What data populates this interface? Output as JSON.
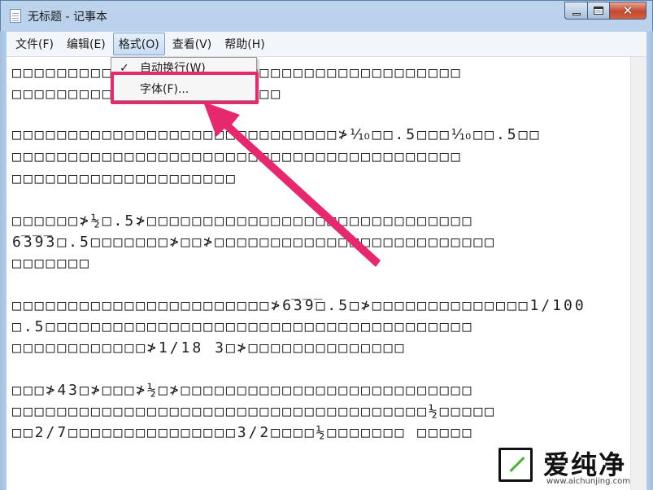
{
  "window": {
    "title": "无标题 - 记事本",
    "icon": "notepad-icon",
    "buttons": {
      "minimize": "minimize-icon",
      "maximize": "maximize-icon",
      "close": "✕"
    }
  },
  "menubar": {
    "items": [
      {
        "label": "文件(F)"
      },
      {
        "label": "编辑(E)"
      },
      {
        "label": "格式(O)",
        "active": true
      },
      {
        "label": "查看(V)"
      },
      {
        "label": "帮助(H)"
      }
    ]
  },
  "format_menu": {
    "items": [
      {
        "label": "自动换行(W)",
        "checked": true,
        "check_glyph": "✓"
      },
      {
        "label": "字体(F)..."
      }
    ]
  },
  "editor": {
    "lines": [
      "□□□□□□□□□□□□□□□□□□□□□□□□□□□□□□□□□□□□□□□□",
      "□□□□□□□□□□□□□□□□□□□□□□□□",
      "□□□□□□□□□□□□□□□□□□□□□□□□□□□□□≯⅒□□.5□□□⅒□□.5□□",
      "□□□□□□□□□□□□□□□□□□□□□□□□□□□□□□□□□□□□□□□□",
      "□□□□□□□□□□□□□□□□□□□□",
      "□□□□□□≯½□.5≯□□□□□□□□□□□□□□□□□□□□□□□□□□□□□",
      "6̅3̅9̅3□.5□□□□□□□≯□□≯□□□□□□□□□□□□□□□□□□□□□□□□□",
      "□□□□□□□",
      "□□□□□□□□□□□□□□□□□□□□□□□≯6̅3̅9̅□.5□≯□□□□□□□□□□□□□□1/100",
      "□.5□□□□□□□□□□□□□□□□□□□□□□□□□□□□□□□□□□□□□□",
      "□□□□□□□□□□□□≯1/18 3□≯□□□□□□□□□□□□□□",
      "□□□≯43□≯□□□≯½□≯□□□□□□□□□□□□□□□□□□□□□□□□□□",
      "□□□□□□□□□□□□□□□□□□□□□□□□□□□□□□□□□□□□□½□□□□□",
      "□□2/7□□□□□□□□□□□□□□□3/2□□□□½□□□□□□□ □□□□□"
    ]
  },
  "annotation": {
    "highlight_color": "#e8286e",
    "arrow_color": "#e8286e"
  },
  "watermark": {
    "text": "爱纯净",
    "url": "www.aichunjing.com"
  }
}
